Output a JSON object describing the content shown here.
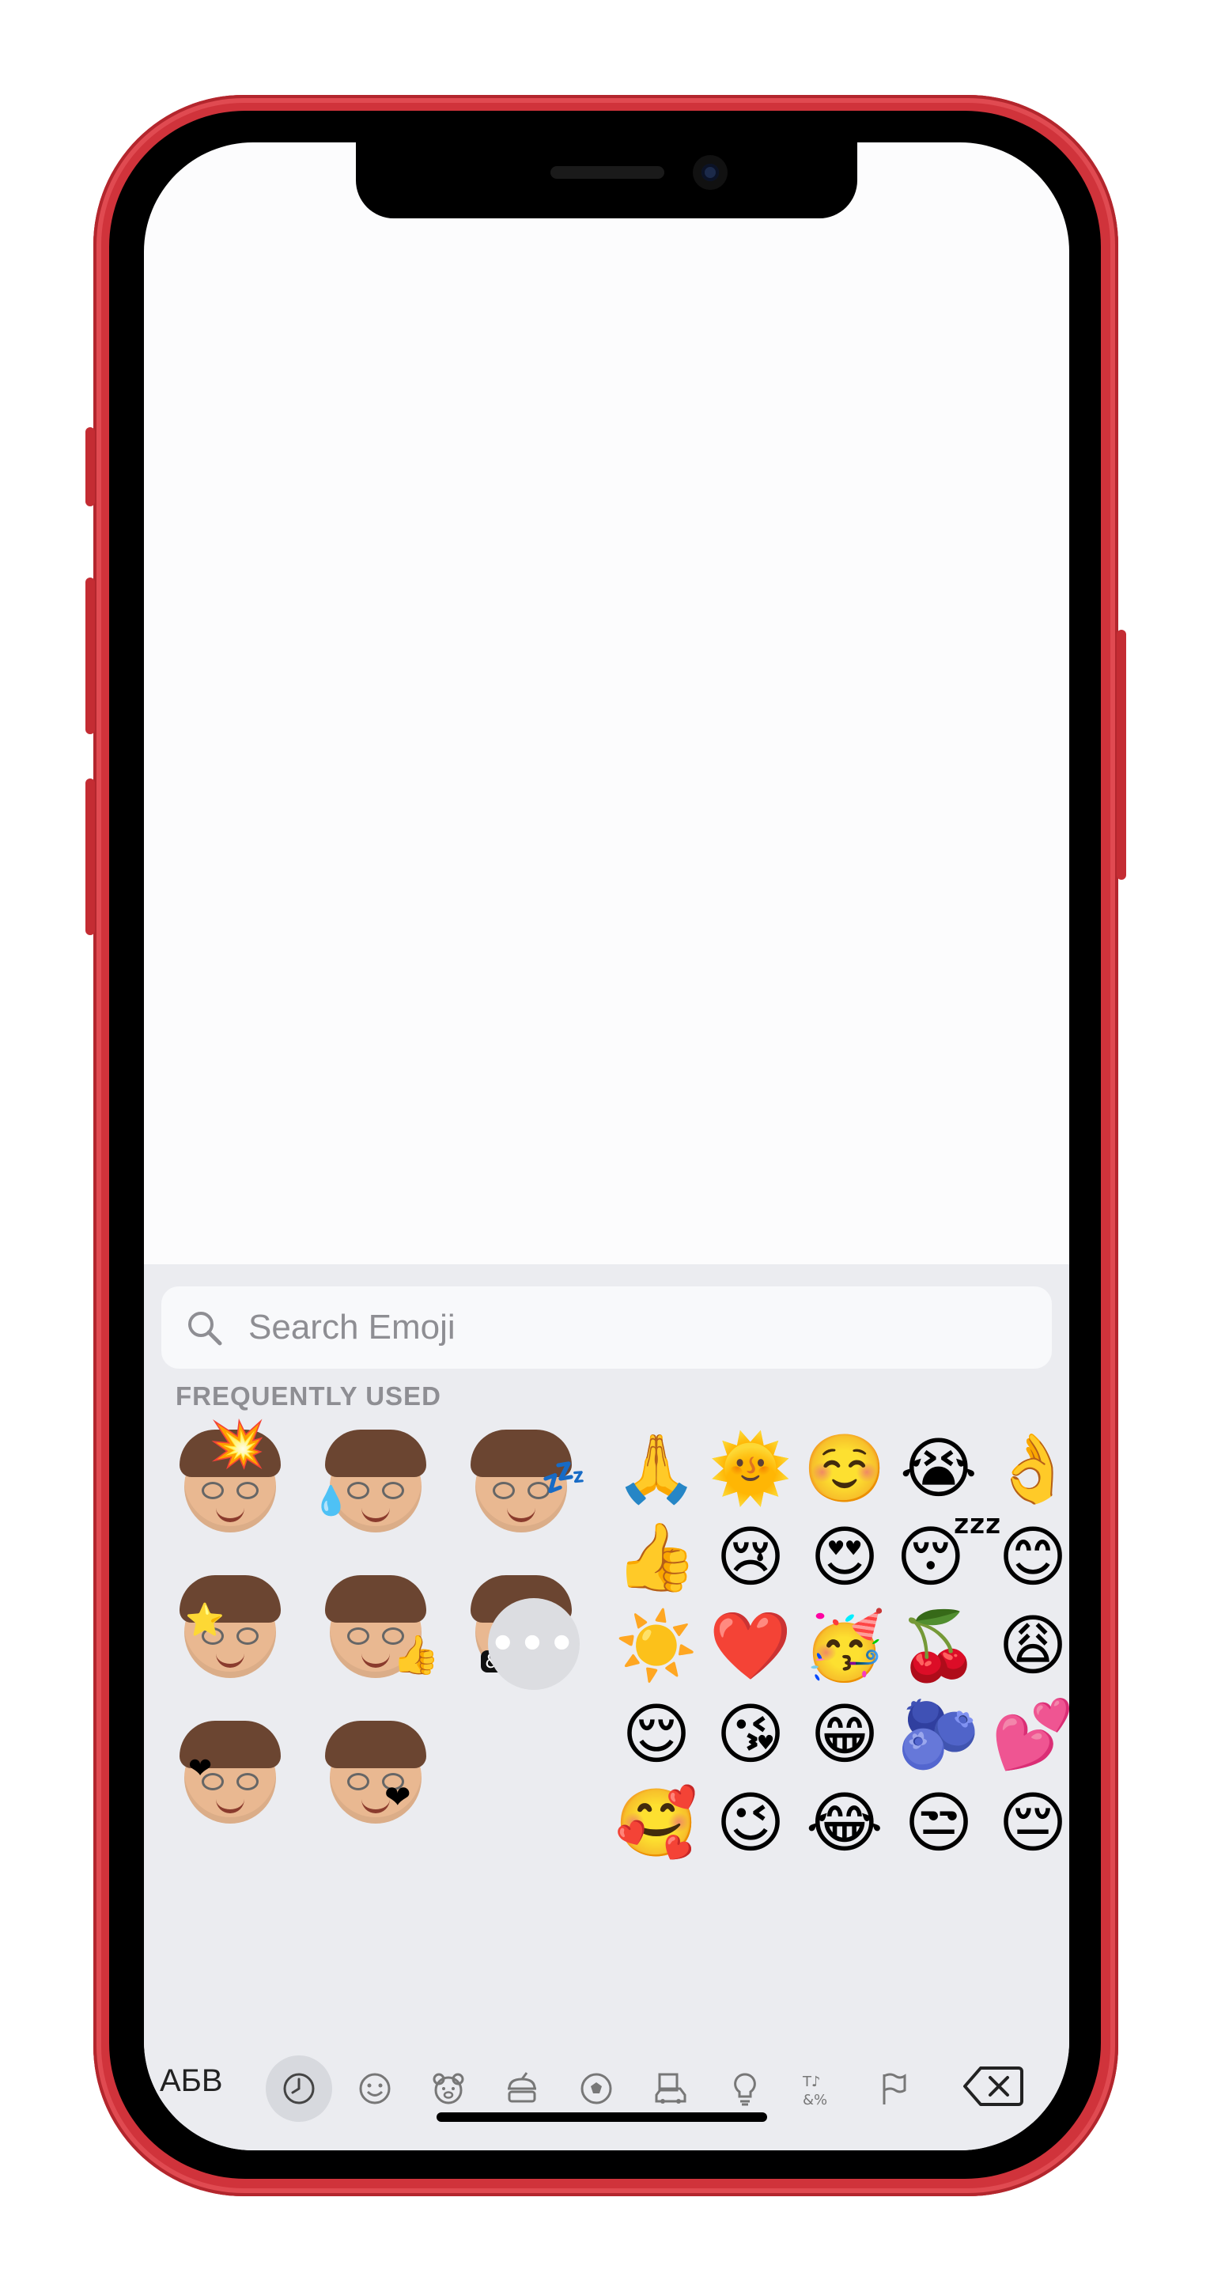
{
  "search": {
    "placeholder": "Search Emoji"
  },
  "section": {
    "title": "FREQUENTLY USED"
  },
  "memojis": [
    {
      "name": "memoji-mind-blown",
      "extra": "💥"
    },
    {
      "name": "memoji-laughing-tears",
      "extra": "💧"
    },
    {
      "name": "memoji-sleeping",
      "extra": "💤"
    },
    {
      "name": "memoji-star-eyes",
      "extra": "⭐"
    },
    {
      "name": "memoji-thumbs-up",
      "extra": "👍"
    },
    {
      "name": "memoji-cursing",
      "extra": "&$!#%"
    },
    {
      "name": "memoji-heart-eyes",
      "extra": "❤"
    },
    {
      "name": "memoji-kiss",
      "extra": "❤"
    }
  ],
  "more_label": "•••",
  "emojis": [
    [
      "🙏",
      "🌞",
      "☺️",
      "😭",
      "👌"
    ],
    [
      "👍",
      "😢",
      "😍",
      "😴",
      "😊"
    ],
    [
      "☀️",
      "❤️",
      "🥳",
      "🍒",
      "😩"
    ],
    [
      "😌",
      "😘",
      "😁",
      "🫐",
      "💕"
    ],
    [
      "🥰",
      "😉",
      "😂",
      "😒",
      "😔"
    ]
  ],
  "keyboard": {
    "abc_label": "АБВ",
    "categories": [
      "recent-clock",
      "smileys",
      "animals",
      "food",
      "activity",
      "travel",
      "objects",
      "symbols",
      "flags"
    ],
    "active_category": "recent-clock"
  },
  "colors": {
    "frame": "#d0333b",
    "keyboard_bg": "#ebecf0",
    "search_bg": "#f8f9fb",
    "secondary_text": "#8e8e93"
  }
}
